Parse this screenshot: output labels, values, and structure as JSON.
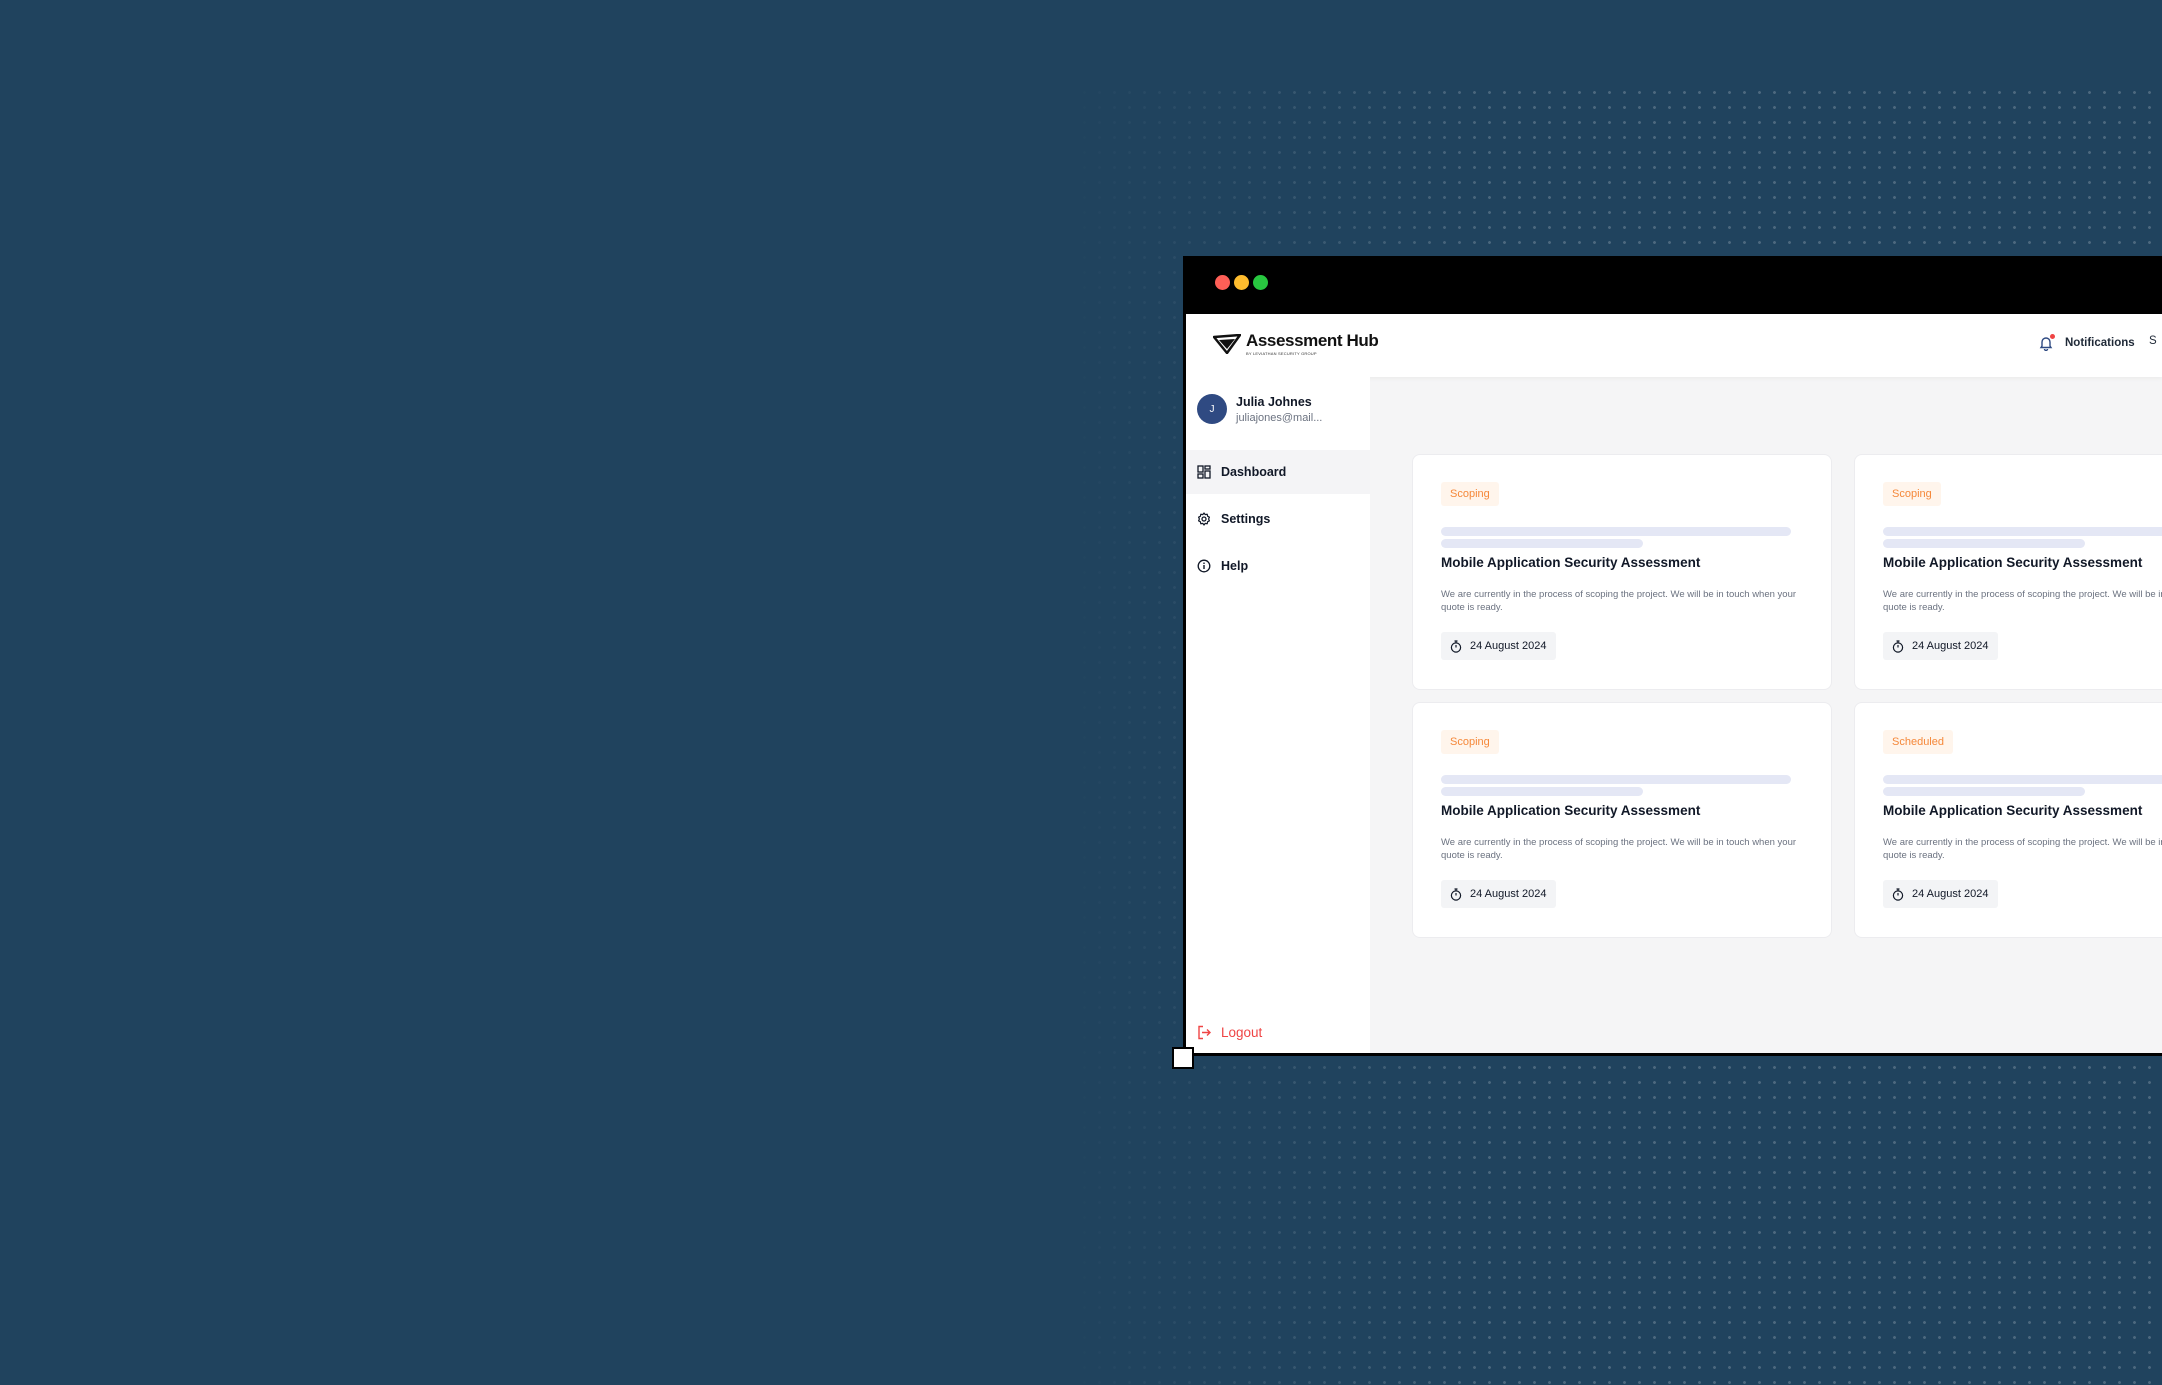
{
  "app": {
    "title": "Assessment Hub",
    "subtitle": "BY LEVIATHAN SECURITY GROUP"
  },
  "header": {
    "notifications_label": "Notifications",
    "cut_text": "S"
  },
  "user": {
    "initial": "J",
    "name": "Julia Johnes",
    "email": "juliajones@mail..."
  },
  "sidebar": {
    "items": [
      {
        "label": "Dashboard",
        "icon": "dashboard-icon",
        "active": true
      },
      {
        "label": "Settings",
        "icon": "gear-icon",
        "active": false
      },
      {
        "label": "Help",
        "icon": "info-icon",
        "active": false
      }
    ],
    "logout_label": "Logout"
  },
  "cards": [
    {
      "status": "Scoping",
      "title": "Mobile Application Security Assessment",
      "description": "We are currently in the process of scoping the project. We will be in touch when your quote is ready.",
      "date": "24 August 2024"
    },
    {
      "status": "Scoping",
      "title": "Mobile Application Security Assessment",
      "description": "We are currently in the process of scoping the project. We will be in touch when your quote is ready.",
      "date": "24 August 2024"
    },
    {
      "status": "Scoping",
      "title": "Mobile Application Security Assessment",
      "description": "We are currently in the process of scoping the project. We will be in touch when your quote is ready.",
      "date": "24 August 2024"
    },
    {
      "status": "Scheduled",
      "title": "Mobile Application Security Assessment",
      "description": "We are currently in the process of scoping the project. We will be in touch when your quote is ready.",
      "date": "24 August 2024"
    }
  ],
  "colors": {
    "background": "#20435e",
    "status_text": "#f5883a",
    "status_bg": "#fff5ec",
    "logout": "#ef4444",
    "avatar": "#2f4a82"
  }
}
